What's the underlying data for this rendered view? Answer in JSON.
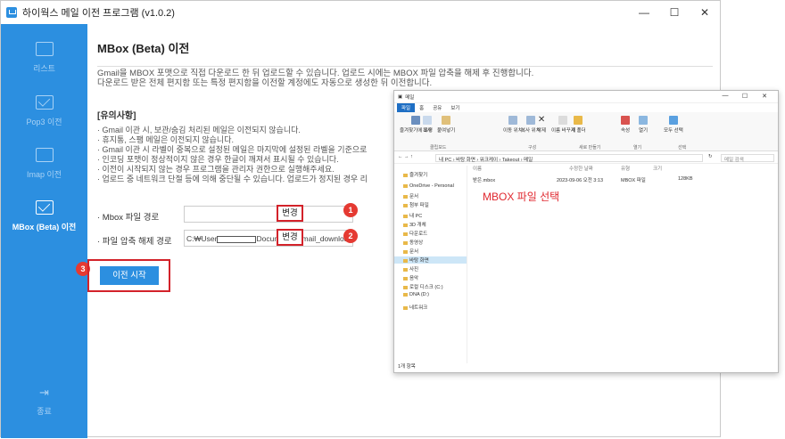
{
  "window": {
    "title": "하이웍스 메일 이전 프로그램 (v1.0.2)",
    "controls": [
      "—",
      "☐",
      "✕"
    ]
  },
  "sidebar": {
    "items": [
      {
        "label": "리스트",
        "icon": "list-icon"
      },
      {
        "label": "Pop3 이전",
        "icon": "mail-icon"
      },
      {
        "label": "Imap 이전",
        "icon": "imap-icon"
      },
      {
        "label": "MBox (Beta) 이전",
        "icon": "mbox-icon",
        "active": true
      }
    ],
    "exit_label": "종료",
    "exit_icon": "exit-icon",
    "accent": "#2c8fe0"
  },
  "main": {
    "title": "MBox (Beta) 이전",
    "description": [
      "Gmail을 MBOX 포맷으로 직접 다운로드 한 뒤 업로드할 수 있습니다. 업로드 시에는 MBOX 파일 압축을 해제 후 진행합니다.",
      "다운로드 받은 전체 편지함 또는 특정 편지함을 이전할 계정에도 자동으로 생성한 뒤 이전합니다."
    ],
    "notes_title": "[유의사항]",
    "notes": [
      "· Gmail 이관 시, 보관/숨김 처리된 메일은 이전되지 않습니다.",
      "· 휴지통, 스팸 메일은 이전되지 않습니다.",
      "· Gmail 이관 시 라벨이 중복으로 설정된 메일은 마지막에 설정된 라벨을 기준으로",
      "· 인코딩 포맷이 정상적이지 않은 경우 한글이 깨져서 표시될 수 있습니다.",
      "· 이전이 시작되지 않는 경우 프로그램을 관리자 권한으로 실행해주세요.",
      "· 업로드 중 네트워크 단절 등에 의해 중단될 수 있습니다. 업로드가 정지된 경우 리"
    ],
    "mbox_label": "· Mbox 파일 경로",
    "mbox_value": "",
    "unzip_label": "· 파일 압축 해제 경로",
    "unzip_prefix": "C:₩User",
    "unzip_suffix": "Documents₩mail_download",
    "change_label": "변경",
    "start_label": "이전 시작",
    "badges": [
      "1",
      "2",
      "3"
    ]
  },
  "explorer": {
    "title": "메일",
    "tabs": [
      "파일",
      "홈",
      "공유",
      "보기"
    ],
    "ribbon_groups": [
      "클립보드",
      "구성",
      "새로 만들기",
      "열기",
      "선택"
    ],
    "ribbon_buttons": [
      "즐겨찾기에 고정",
      "복사",
      "붙여넣기",
      "이동 위치",
      "복사 위치",
      "삭제",
      "이름 바꾸기",
      "새 폴더",
      "속성",
      "열기",
      "모두 선택"
    ],
    "path": "내 PC › 바탕 화면 › 워크케이 › Takeout › 메일",
    "search_placeholder": "메일 검색",
    "nav": [
      "즐겨찾기",
      "OneDrive - Personal",
      "문서",
      "첨부 파일",
      "내 PC",
      "3D 개체",
      "다운로드",
      "동영상",
      "문서",
      "바탕 화면",
      "사진",
      "음악",
      "로컬 디스크 (C:)",
      "DNA (D:)",
      "네트워크"
    ],
    "columns": [
      "이름",
      "수정한 날짜",
      "유형",
      "크기"
    ],
    "file": {
      "name": "받은.mbox",
      "date": "2023-09-06 오전 3:13",
      "type": "MBOX 파일",
      "size": "128KB"
    },
    "status": "1개 항목"
  },
  "overlay": {
    "label": "MBOX 파일 선택",
    "color": "#e0282f"
  }
}
